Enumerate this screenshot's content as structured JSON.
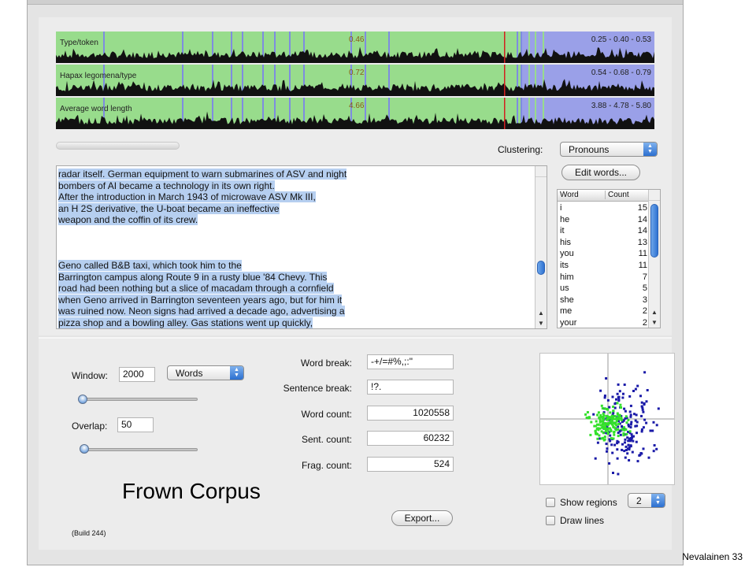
{
  "strips": [
    {
      "label": "Type/token",
      "value": "0.46",
      "range": "0.25 - 0.40 - 0.53"
    },
    {
      "label": "Hapax legomena/type",
      "value": "0.72",
      "range": "0.54 - 0.68 - 0.79"
    },
    {
      "label": "Average word length",
      "value": "4.66",
      "range": "3.88 - 4.78 - 5.80"
    }
  ],
  "colors": {
    "green": "#98dc8c",
    "blue": "#9aa0e8",
    "marker_blue": "#7e8ce0",
    "cursor": "#d22020",
    "highlight": "#b6cff0"
  },
  "clustering": {
    "label": "Clustering:",
    "value": "Pronouns"
  },
  "edit_words_label": "Edit words...",
  "text_lines": [
    "radar itself. German equipment to warn submarines of ASV and night",
    "bombers of AI became a technology in its own right.",
    "After the introduction in March 1943 of microwave ASV Mk III,",
    "an H 2S derivative, the U-boat became an ineffective",
    "weapon and the coffin of its crew.",
    "",
    "",
    "",
    "Geno called B&B taxi, which took him to the",
    "Barrington campus along Route 9 in a rusty blue '84 Chevy. This",
    "road had been nothing but a slice of macadam through a cornfield",
    "when Geno arrived in Barrington seventeen years ago, but for him it",
    "was ruined now. Neon signs had arrived a decade ago, advertising a",
    "pizza shop and a bowling alley. Gas stations went up quickly,"
  ],
  "wordlist": {
    "headers": {
      "word": "Word",
      "count": "Count"
    },
    "rows": [
      {
        "word": "i",
        "count": "15"
      },
      {
        "word": "he",
        "count": "14"
      },
      {
        "word": "it",
        "count": "14"
      },
      {
        "word": "his",
        "count": "13"
      },
      {
        "word": "you",
        "count": "11"
      },
      {
        "word": "its",
        "count": "11"
      },
      {
        "word": "him",
        "count": "7"
      },
      {
        "word": "us",
        "count": "5"
      },
      {
        "word": "she",
        "count": "3"
      },
      {
        "word": "me",
        "count": "2"
      },
      {
        "word": "your",
        "count": "2"
      }
    ]
  },
  "settings": {
    "window_label": "Window:",
    "window_value": "2000",
    "unit_value": "Words",
    "overlap_label": "Overlap:",
    "overlap_value": "50",
    "word_break_label": "Word break:",
    "word_break_value": "-+/=#%,;:\"",
    "sentence_break_label": "Sentence break:",
    "sentence_break_value": "!?.",
    "word_count_label": "Word count:",
    "word_count_value": "1020558",
    "sent_count_label": "Sent. count:",
    "sent_count_value": "60232",
    "frag_count_label": "Frag. count:",
    "frag_count_value": "524"
  },
  "export_label": "Export...",
  "build_label": "(Build 244)",
  "show_regions_label": "Show regions",
  "regions_value": "2",
  "draw_lines_label": "Draw lines",
  "overlay_title": "Frown Corpus",
  "footer": "Nevalainen 33",
  "icons": {
    "arrow_up": "▲",
    "arrow_down": "▼"
  }
}
